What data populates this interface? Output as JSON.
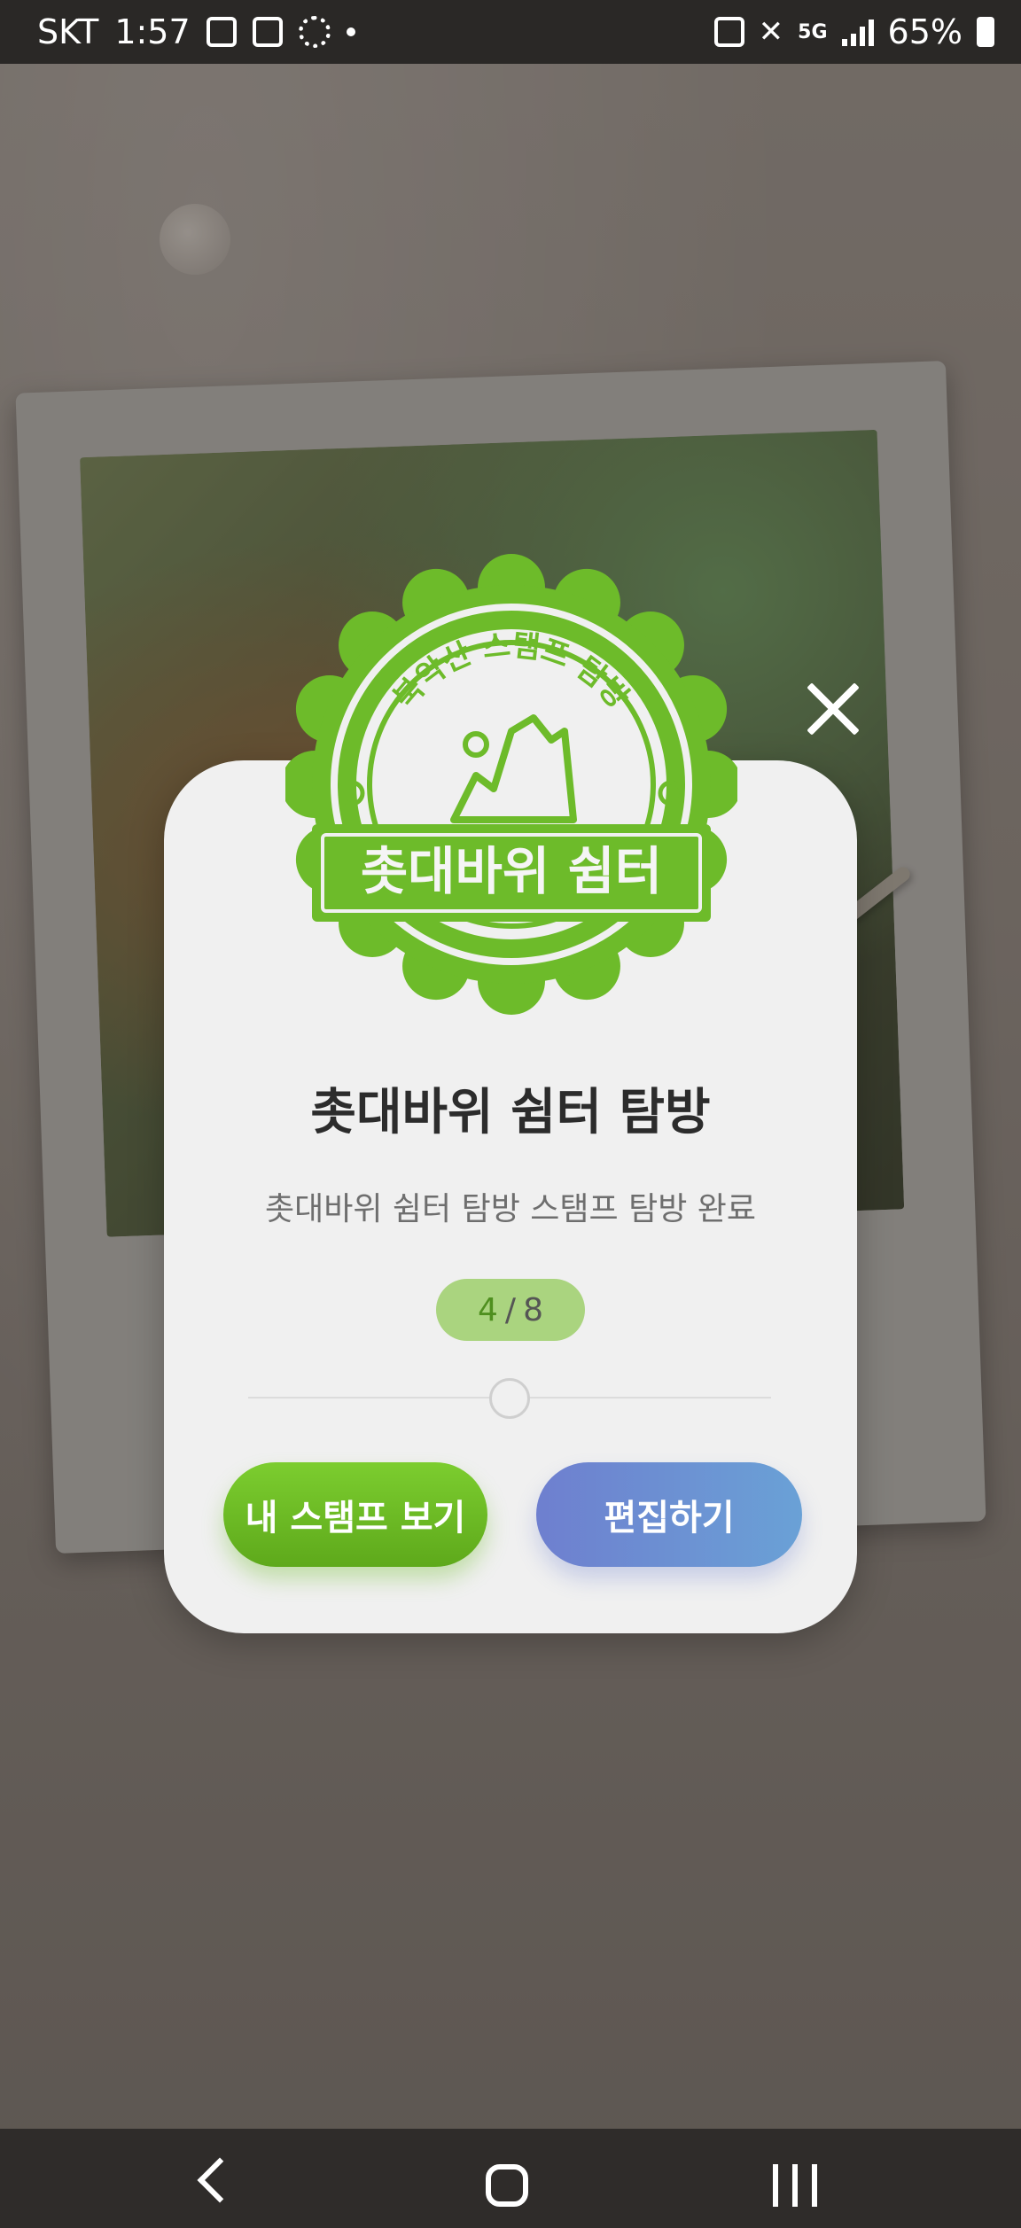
{
  "status_bar": {
    "carrier": "SKT",
    "time": "1:57",
    "network": "5G",
    "battery": "65%"
  },
  "stamp": {
    "arc_text": "북악산 스탬프 탐방",
    "banner_text": "촛대바위 쉼터",
    "color": "#6dbb2a"
  },
  "modal": {
    "title": "촛대바위 쉼터 탐방",
    "subtitle": "촛대바위 쉼터 탐방 스탬프 탐방 완료",
    "progress": {
      "current": "4",
      "separator": "/",
      "total": "8"
    },
    "buttons": {
      "my_stamps": "내 스탬프 보기",
      "edit": "편집하기"
    }
  },
  "colors": {
    "accent_green": "#6dbb2a",
    "accent_blue": "#6e8fd2"
  },
  "icons": [
    "close-icon",
    "back-icon",
    "home-icon",
    "recent-apps-icon"
  ]
}
